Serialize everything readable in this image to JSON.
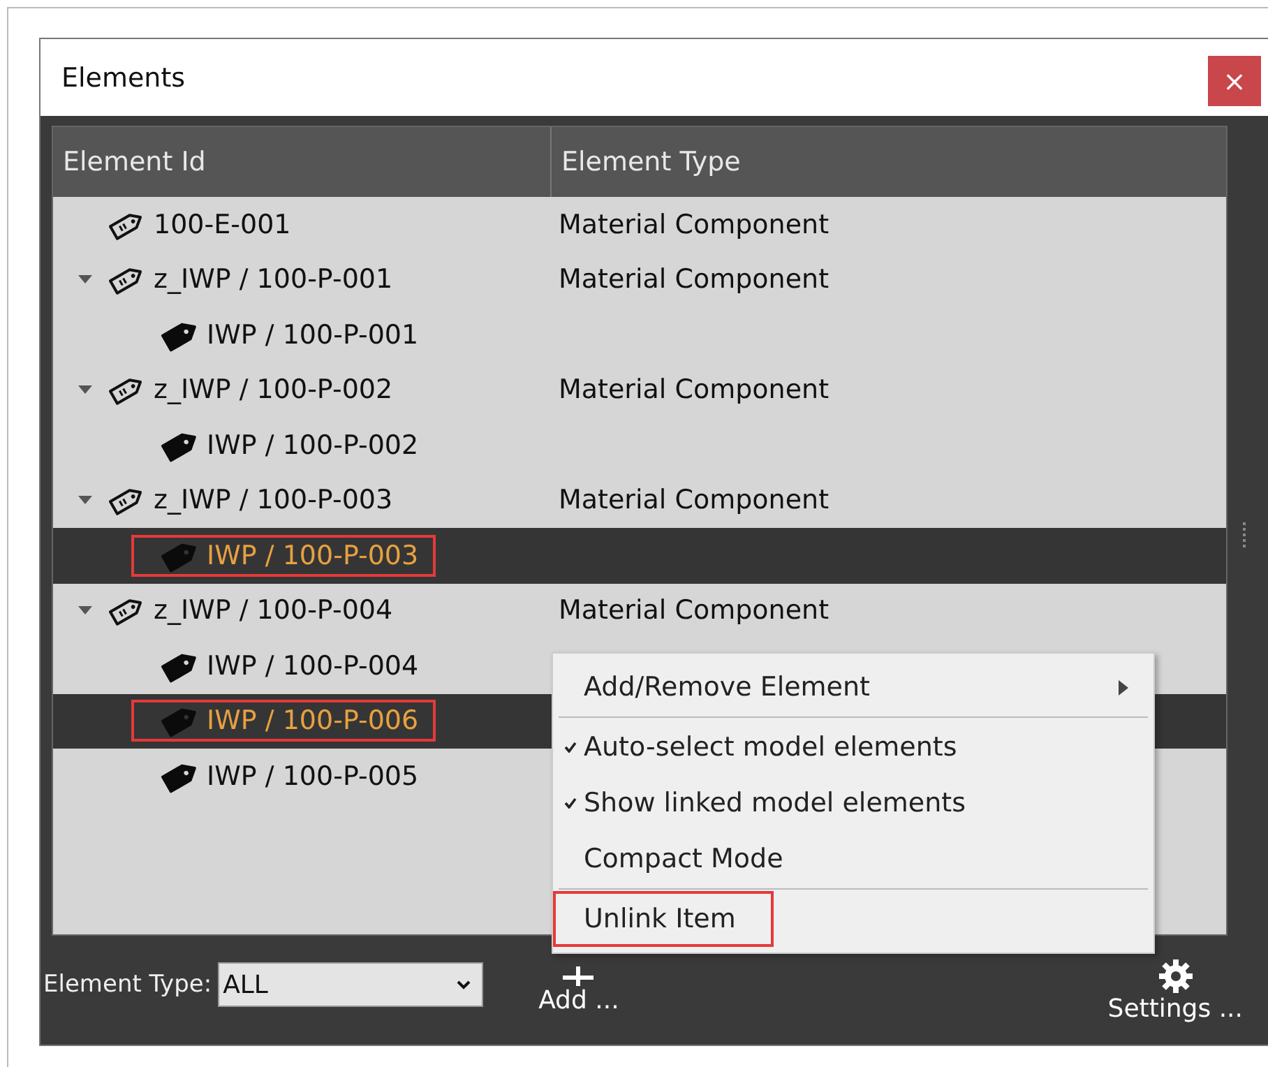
{
  "window": {
    "title": "Elements",
    "close": "×"
  },
  "table": {
    "columns": [
      "Element Id",
      "Element Type"
    ],
    "rows": [
      {
        "id": "100-E-001",
        "type": "Material Component",
        "kind": "outline-tag",
        "selected": false,
        "outlined": false
      },
      {
        "id": "z_IWP / 100-P-001",
        "type": "Material Component",
        "kind": "outline-tag",
        "expanded": true,
        "selected": false,
        "outlined": false,
        "children": [
          {
            "id": "IWP / 100-P-001",
            "kind": "solid-tag",
            "selected": false,
            "outlined": false
          }
        ]
      },
      {
        "id": "z_IWP / 100-P-002",
        "type": "Material Component",
        "kind": "outline-tag",
        "expanded": true,
        "selected": false,
        "outlined": false,
        "children": [
          {
            "id": "IWP / 100-P-002",
            "kind": "solid-tag",
            "selected": false,
            "outlined": false
          }
        ]
      },
      {
        "id": "z_IWP / 100-P-003",
        "type": "Material Component",
        "kind": "outline-tag",
        "expanded": true,
        "selected": false,
        "outlined": false,
        "children": [
          {
            "id": "IWP / 100-P-003",
            "kind": "solid-tag",
            "selected": true,
            "outlined": true
          }
        ]
      },
      {
        "id": "z_IWP / 100-P-004",
        "type": "Material Component",
        "kind": "outline-tag",
        "expanded": true,
        "selected": false,
        "outlined": false,
        "children": [
          {
            "id": "IWP / 100-P-004",
            "kind": "solid-tag",
            "selected": false,
            "outlined": false
          },
          {
            "id": "IWP / 100-P-006",
            "kind": "solid-tag",
            "selected": true,
            "outlined": true
          },
          {
            "id": "IWP / 100-P-005",
            "kind": "solid-tag",
            "selected": false,
            "outlined": false
          }
        ]
      }
    ]
  },
  "filter": {
    "label": "Element Type:",
    "value": "ALL"
  },
  "actions": [
    {
      "label": "Add ...",
      "kind": "add"
    },
    {
      "label": "Settings ...",
      "kind": "settings"
    }
  ],
  "context_menu": {
    "items": [
      {
        "label": "Add/Remove Element",
        "kind": "submenu",
        "checked": false,
        "outlined": false,
        "separator_after": true
      },
      {
        "label": "Auto-select model elements",
        "kind": "toggle",
        "checked": true,
        "outlined": false,
        "separator_after": false
      },
      {
        "label": "Show linked model elements",
        "kind": "toggle",
        "checked": true,
        "outlined": false,
        "separator_after": false
      },
      {
        "label": "Compact Mode",
        "kind": "toggle",
        "checked": false,
        "outlined": false,
        "separator_after": true
      },
      {
        "label": "Unlink Item",
        "kind": "action",
        "checked": false,
        "outlined": true,
        "separator_after": false
      }
    ]
  }
}
